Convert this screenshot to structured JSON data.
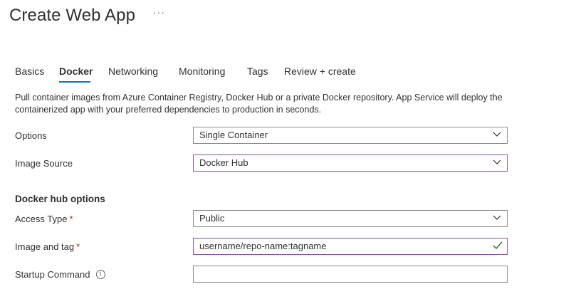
{
  "header": {
    "title": "Create Web App",
    "more_label": "···"
  },
  "tabs": [
    {
      "label": "Basics",
      "active": false
    },
    {
      "label": "Docker",
      "active": true
    },
    {
      "label": "Networking",
      "active": false
    },
    {
      "label": "Monitoring",
      "active": false
    },
    {
      "label": "Tags",
      "active": false
    },
    {
      "label": "Review + create",
      "active": false
    }
  ],
  "description": "Pull container images from Azure Container Registry, Docker Hub or a private Docker repository. App Service will deploy the containerized app with your preferred dependencies to production in seconds.",
  "form": {
    "options": {
      "label": "Options",
      "value": "Single Container"
    },
    "image_source": {
      "label": "Image Source",
      "value": "Docker Hub"
    },
    "section_title": "Docker hub options",
    "access_type": {
      "label": "Access Type",
      "required": "*",
      "value": "Public"
    },
    "image_tag": {
      "label": "Image and tag",
      "required": "*",
      "value": "username/repo-name:tagname"
    },
    "startup_command": {
      "label": "Startup Command",
      "info_icon": "i",
      "value": ""
    }
  },
  "colors": {
    "accent": "#0078d4",
    "focus_border": "#8c4f9c",
    "valid_check": "#107c10",
    "required": "#a4262c"
  }
}
